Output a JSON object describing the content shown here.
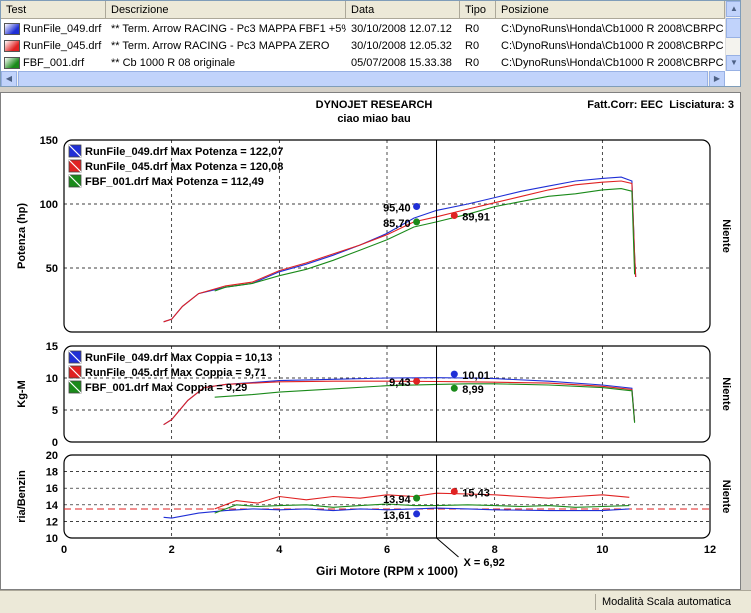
{
  "file_table": {
    "columns": [
      "Test",
      "Descrizione",
      "Data",
      "Tipo",
      "Posizione"
    ],
    "rows": [
      {
        "test": "RunFile_049.drf",
        "descrizione": "** Term. Arrow RACING - Pc3 MAPPA FBF1 +5%",
        "data": "30/10/2008 12.07.12",
        "tipo": "R0",
        "posizione": "C:\\DynoRuns\\Honda\\Cb1000 R 2008\\CBRPC",
        "color": "#1f2fd6"
      },
      {
        "test": "RunFile_045.drf",
        "descrizione": "** Term. Arrow RACING - Pc3 MAPPA ZERO",
        "data": "30/10/2008 12.05.32",
        "tipo": "R0",
        "posizione": "C:\\DynoRuns\\Honda\\Cb1000 R 2008\\CBRPC",
        "color": "#e02222"
      },
      {
        "test": "FBF_001.drf",
        "descrizione": "** Cb 1000 R 08 originale",
        "data": "05/07/2008 15.33.38",
        "tipo": "R0",
        "posizione": "C:\\DynoRuns\\Honda\\Cb1000 R 2008\\CBRPC",
        "color": "#1a8a1a"
      }
    ]
  },
  "chart_header": {
    "title": "DYNOJET RESEARCH",
    "subtitle": "ciao miao bau",
    "correction": "Fatt.Corr: EEC  Lisciatura: 3"
  },
  "status_bar": {
    "text": "Modalità Scala automatica"
  },
  "cursor_label": "X = 6,92",
  "chart_data": [
    {
      "type": "line",
      "ylabel": "Potenza (hp)",
      "right_label": "Niente",
      "ylim": [
        0,
        150
      ],
      "yticks": [
        50,
        100,
        150
      ],
      "legend": [
        "RunFile_049.drf Max Potenza = 122,07",
        "RunFile_045.drf Max Potenza = 120,08",
        "FBF_001.drf Max Potenza = 112,49"
      ],
      "markers": [
        {
          "x": 6.55,
          "y": 98,
          "label": "95,40",
          "color": "#1f2fd6",
          "side": "left"
        },
        {
          "x": 7.25,
          "y": 91,
          "label": "89,91",
          "color": "#e02222",
          "side": "right"
        },
        {
          "x": 6.55,
          "y": 86,
          "label": "85,70",
          "color": "#1a8a1a",
          "side": "left"
        }
      ],
      "series": [
        {
          "color": "#1f2fd6",
          "x": [
            1.85,
            2.0,
            2.2,
            2.5,
            3.0,
            3.5,
            4.0,
            4.5,
            5.0,
            5.5,
            6.0,
            6.5,
            6.92,
            7.5,
            8.0,
            8.5,
            9.0,
            9.5,
            10.0,
            10.35,
            10.55,
            10.6,
            10.62
          ],
          "y": [
            8,
            10,
            20,
            30,
            35,
            38,
            47,
            53,
            60,
            68,
            77,
            89,
            95,
            100,
            105,
            110,
            114,
            118,
            120,
            121,
            118,
            60,
            43
          ]
        },
        {
          "color": "#e02222",
          "x": [
            1.85,
            2.0,
            2.2,
            2.5,
            3.0,
            3.5,
            4.0,
            4.5,
            5.0,
            5.5,
            6.0,
            6.5,
            6.92,
            7.5,
            8.0,
            8.5,
            9.0,
            9.5,
            10.0,
            10.35,
            10.55,
            10.6,
            10.62
          ],
          "y": [
            8,
            10,
            20,
            30,
            36,
            39,
            48,
            54,
            61,
            68,
            76,
            86,
            90,
            96,
            101,
            106,
            111,
            115,
            117,
            118,
            116,
            60,
            43
          ]
        },
        {
          "color": "#1a8a1a",
          "x": [
            2.8,
            3.0,
            3.5,
            4.0,
            4.5,
            5.0,
            5.5,
            6.0,
            6.5,
            6.92,
            7.5,
            8.0,
            8.5,
            9.0,
            9.5,
            10.0,
            10.35,
            10.55,
            10.6
          ],
          "y": [
            32,
            35,
            38,
            44,
            49,
            56,
            64,
            72,
            82,
            86,
            92,
            98,
            102,
            106,
            108,
            111,
            112,
            110,
            45
          ]
        }
      ]
    },
    {
      "type": "line",
      "ylabel": "Kg-M",
      "right_label": "Niente",
      "ylim": [
        0,
        15
      ],
      "yticks": [
        0,
        5,
        10,
        15
      ],
      "legend": [
        "RunFile_049.drf Max Coppia = 10,13",
        "RunFile_045.drf Max Coppia = 9,71",
        "FBF_001.drf Max Coppia = 9,29"
      ],
      "markers": [
        {
          "x": 7.25,
          "y": 10.6,
          "label": "10,01",
          "color": "#1f2fd6",
          "side": "right"
        },
        {
          "x": 6.55,
          "y": 9.5,
          "label": "9,43",
          "color": "#e02222",
          "side": "left"
        },
        {
          "x": 7.25,
          "y": 8.4,
          "label": "8,99",
          "color": "#1a8a1a",
          "side": "right"
        }
      ],
      "series": [
        {
          "color": "#1f2fd6",
          "x": [
            1.85,
            2.0,
            2.3,
            2.6,
            3.0,
            3.5,
            4.0,
            5.0,
            6.0,
            6.92,
            7.5,
            8.0,
            9.0,
            10.0,
            10.55,
            10.6
          ],
          "y": [
            2.7,
            3.5,
            6.5,
            8.5,
            9.0,
            9.3,
            9.6,
            9.8,
            10.0,
            10.05,
            10.0,
            9.9,
            9.5,
            8.9,
            8.4,
            3.2
          ]
        },
        {
          "color": "#e02222",
          "x": [
            1.85,
            2.0,
            2.3,
            2.6,
            3.0,
            3.5,
            4.0,
            5.0,
            6.0,
            6.92,
            7.5,
            8.0,
            9.0,
            10.0,
            10.55,
            10.6
          ],
          "y": [
            2.7,
            3.5,
            6.5,
            8.5,
            9.0,
            9.2,
            9.4,
            9.5,
            9.5,
            9.45,
            9.4,
            9.35,
            9.2,
            8.7,
            8.2,
            3.2
          ]
        },
        {
          "color": "#1a8a1a",
          "x": [
            2.8,
            3.5,
            4.0,
            5.0,
            6.0,
            6.92,
            7.5,
            8.0,
            9.0,
            10.0,
            10.55,
            10.6
          ],
          "y": [
            7.0,
            7.4,
            7.8,
            8.3,
            8.8,
            9.0,
            9.1,
            9.1,
            8.9,
            8.5,
            8.0,
            3.0
          ]
        }
      ]
    },
    {
      "type": "line",
      "ylabel": "ria/Benzin",
      "right_label": "Niente",
      "xlabel": "Giri Motore (RPM x 1000)",
      "ylim": [
        10,
        20
      ],
      "yticks": [
        10,
        12,
        14,
        16,
        18,
        20
      ],
      "xlim": [
        0,
        12
      ],
      "xticks": [
        0,
        2,
        4,
        6,
        8,
        10,
        12
      ],
      "reference_line": 13.5,
      "markers": [
        {
          "x": 7.25,
          "y": 15.6,
          "label": "15,43",
          "color": "#e02222",
          "side": "right"
        },
        {
          "x": 6.55,
          "y": 14.8,
          "label": "13,94",
          "color": "#1a8a1a",
          "side": "left"
        },
        {
          "x": 6.55,
          "y": 12.9,
          "label": "13,61",
          "color": "#1f2fd6",
          "side": "left"
        }
      ],
      "series": [
        {
          "color": "#1f2fd6",
          "x": [
            1.85,
            2.0,
            2.5,
            3.0,
            3.5,
            4.0,
            4.5,
            5.0,
            5.5,
            6.0,
            6.5,
            6.92,
            7.5,
            8.0,
            9.0,
            10.0,
            10.5
          ],
          "y": [
            12.5,
            12.4,
            13.0,
            13.3,
            13.5,
            13.4,
            13.5,
            13.3,
            13.5,
            13.4,
            13.5,
            13.6,
            13.5,
            13.4,
            13.3,
            13.3,
            13.5
          ]
        },
        {
          "color": "#e02222",
          "x": [
            2.8,
            3.2,
            3.6,
            4.0,
            4.5,
            5.0,
            5.5,
            6.0,
            6.5,
            6.92,
            7.5,
            8.0,
            8.5,
            9.0,
            9.5,
            10.0,
            10.5
          ],
          "y": [
            13.5,
            14.5,
            14.2,
            15.0,
            14.6,
            15.0,
            14.8,
            15.2,
            15.0,
            15.4,
            15.3,
            15.2,
            15.0,
            14.8,
            15.0,
            15.2,
            14.9
          ]
        },
        {
          "color": "#1a8a1a",
          "x": [
            2.8,
            3.2,
            3.6,
            4.0,
            4.5,
            5.0,
            5.5,
            6.0,
            6.5,
            6.92,
            7.5,
            8.0,
            8.5,
            9.0,
            9.5,
            10.0,
            10.5
          ],
          "y": [
            13.0,
            14.0,
            13.8,
            13.9,
            14.0,
            13.7,
            13.9,
            14.1,
            13.9,
            13.9,
            14.0,
            13.9,
            13.8,
            13.9,
            13.7,
            13.8,
            13.9
          ]
        }
      ]
    }
  ]
}
